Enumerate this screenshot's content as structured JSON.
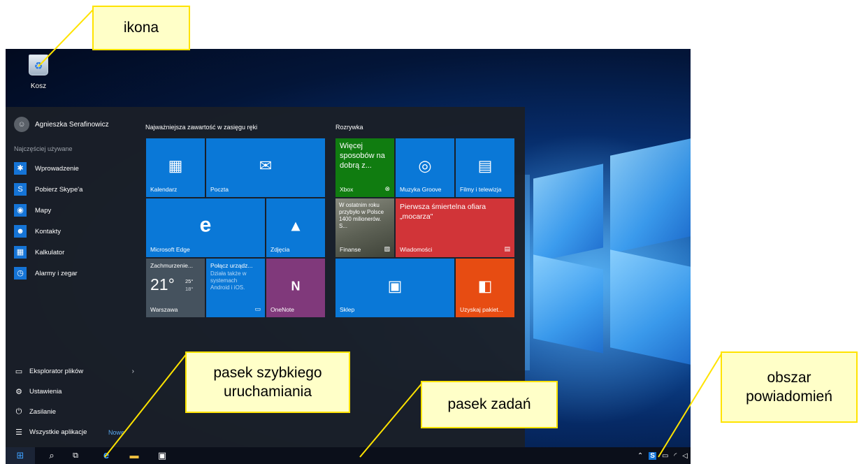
{
  "callouts": {
    "icon": "ikona",
    "quick_launch": "pasek szybkiego uruchamiania",
    "taskbar": "pasek zadań",
    "notification_area": "obszar powiadomień"
  },
  "desktop": {
    "recycle_bin_label": "Kosz"
  },
  "start_menu": {
    "user_name": "Agnieszka Serafinowicz",
    "most_used_heading": "Najczęściej używane",
    "most_used": [
      {
        "label": "Wprowadzenie",
        "icon": "lightbulb-icon"
      },
      {
        "label": "Pobierz Skype'a",
        "icon": "skype-icon"
      },
      {
        "label": "Mapy",
        "icon": "map-pin-icon"
      },
      {
        "label": "Kontakty",
        "icon": "people-icon"
      },
      {
        "label": "Kalkulator",
        "icon": "calculator-icon"
      },
      {
        "label": "Alarmy i zegar",
        "icon": "alarm-clock-icon"
      }
    ],
    "bottom": {
      "file_explorer": "Eksplorator plików",
      "settings": "Ustawienia",
      "power": "Zasilanie",
      "all_apps": "Wszystkie aplikacje",
      "new_badge": "Nowe"
    },
    "group_main_title": "Najważniejsza zawartość w zasięgu ręki",
    "group_fun_title": "Rozrywka",
    "tiles": {
      "calendar": "Kalendarz",
      "mail": "Poczta",
      "edge": "Microsoft Edge",
      "photos": "Zdjęcia",
      "weather_condition": "Zachmurzenie...",
      "weather_temp": "21°",
      "weather_high": "25°",
      "weather_low": "18°",
      "weather_city": "Warszawa",
      "phone_title": "Połącz urządz...",
      "phone_desc": "Działa także w systemach Android i iOS.",
      "onenote": "OneNote",
      "xbox_promo": "Więcej sposobów na dobrą z...",
      "xbox": "Xbox",
      "groove": "Muzyka Groove",
      "movies": "Filmy i telewizja",
      "finance_news": "W ostatnim roku przybyło w Polsce 1400 milionerów. S...",
      "finance": "Finanse",
      "news_headline": "Pierwsza śmiertelna ofiara „mocarza\"",
      "news": "Wiadomości",
      "store": "Sklep",
      "office": "Uzyskaj pakiet..."
    }
  },
  "colors": {
    "tile_blue": "#0a78d7",
    "tile_green": "#107c10",
    "tile_purple": "#80397b",
    "tile_red": "#d13438",
    "tile_orange": "#e74c12",
    "callout_border": "#ffe300",
    "callout_fill": "#ffffc8"
  }
}
